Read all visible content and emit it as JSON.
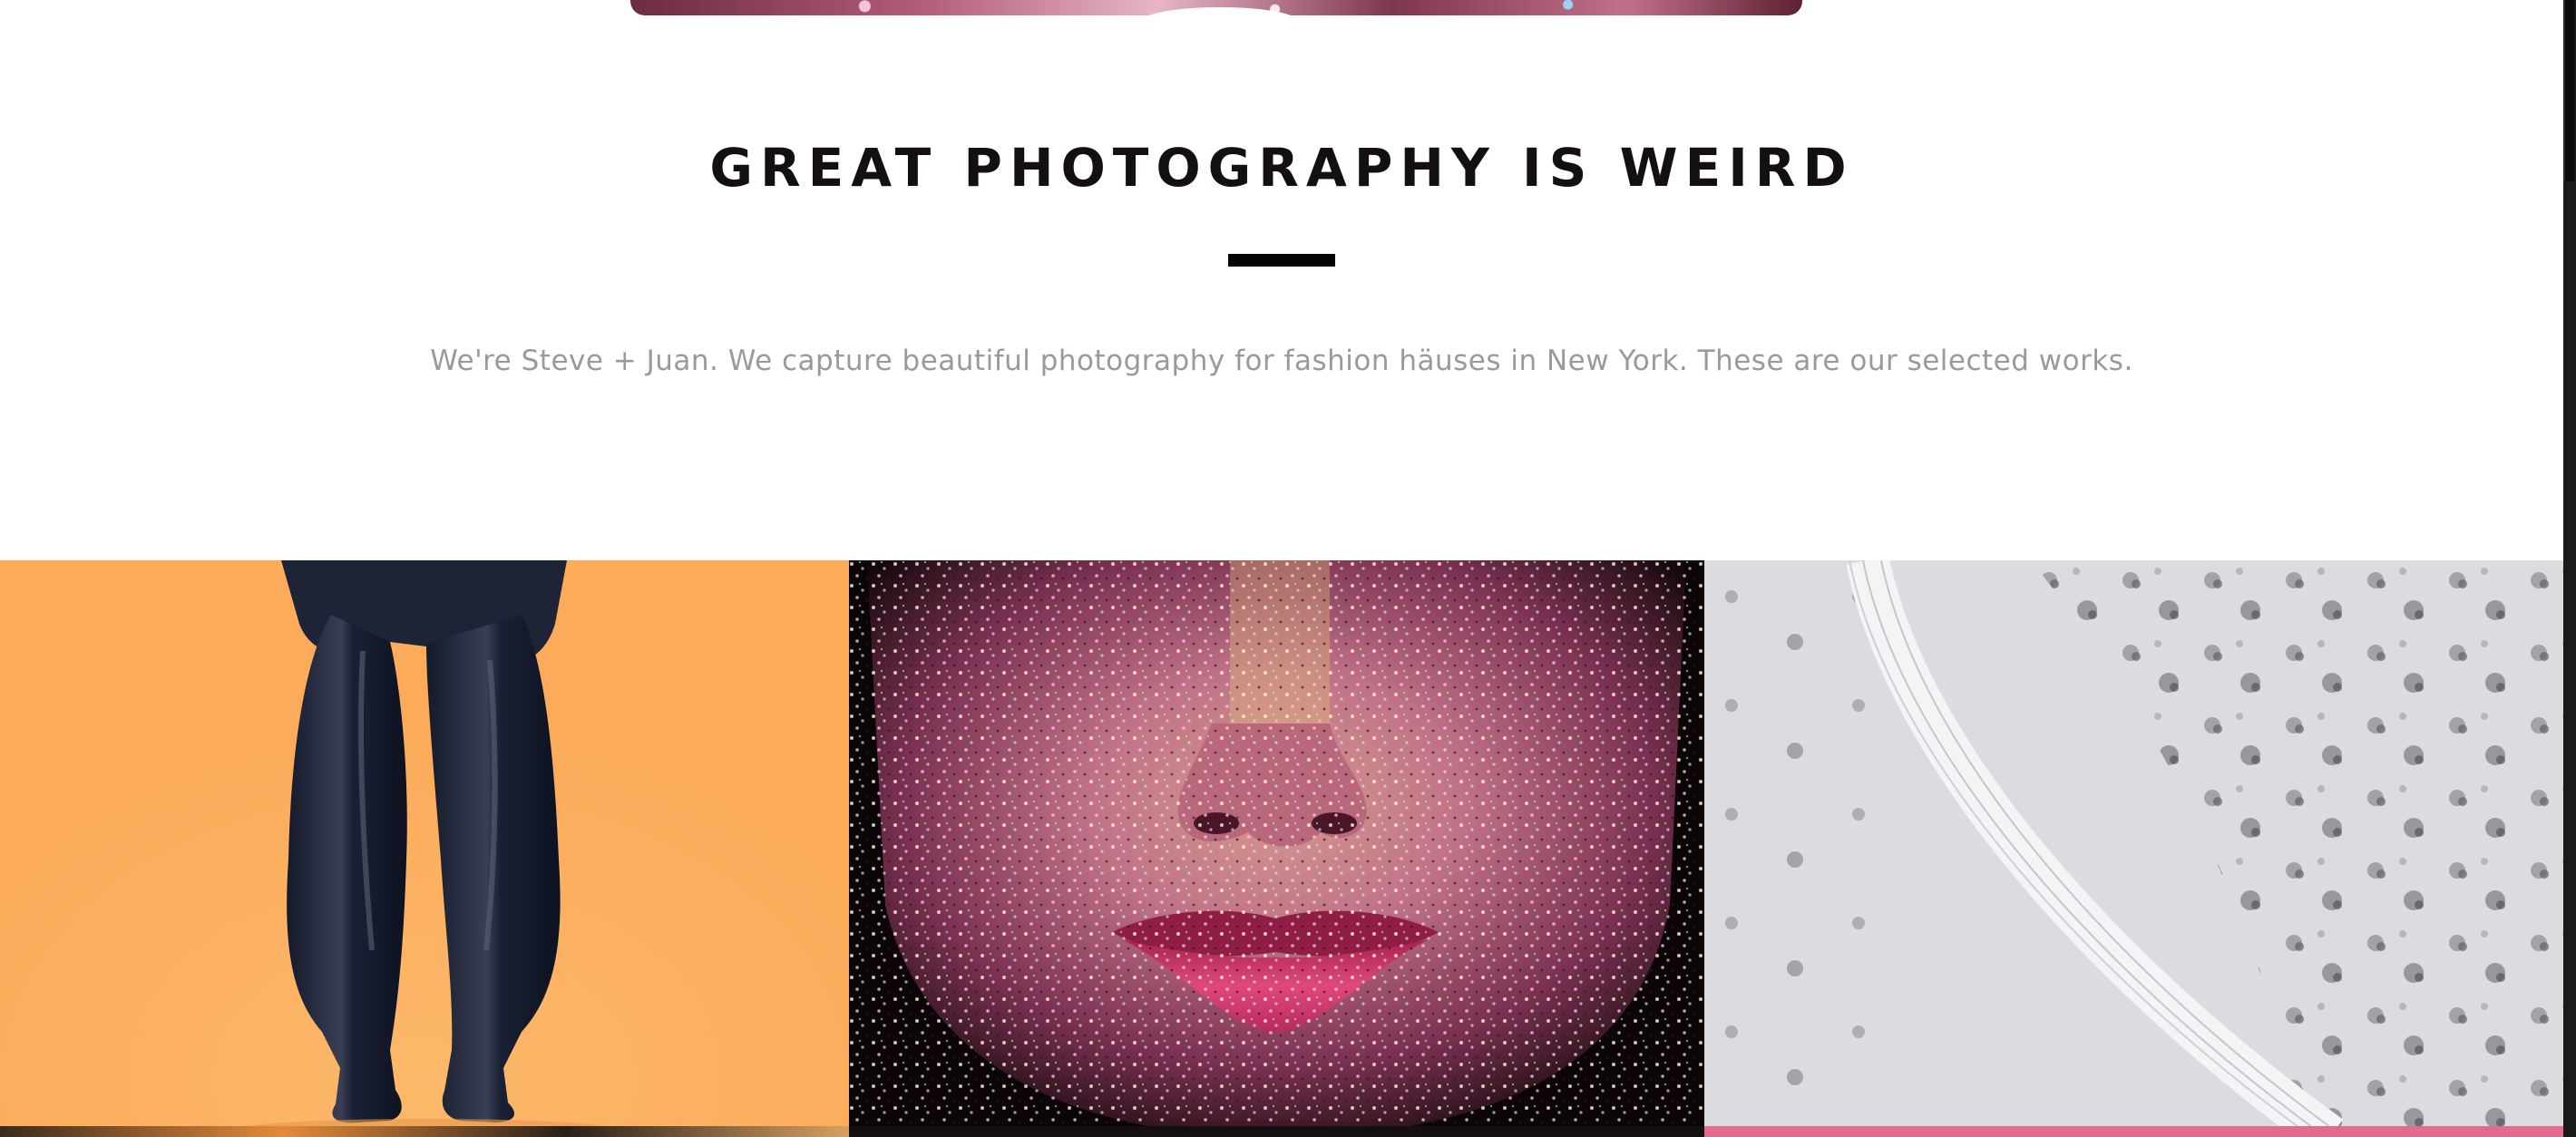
{
  "intro": {
    "title": "GREAT PHOTOGRAPHY IS WEIRD",
    "subtitle": "We're Steve + Juan. We capture beautiful photography for fashion häuses in New York. These are our selected works."
  },
  "gallery": {
    "tiles": [
      {
        "name": "orange-figure-photo",
        "accent": "#fbab5a"
      },
      {
        "name": "glitter-face-photo",
        "accent": "#b45c7a"
      },
      {
        "name": "snowy-forest-aerial-photo",
        "accent": "#d6d5db"
      }
    ]
  },
  "colors": {
    "heading": "#141010",
    "divider": "#050505",
    "subtitle": "#9a9a9a",
    "background": "#ffffff"
  }
}
